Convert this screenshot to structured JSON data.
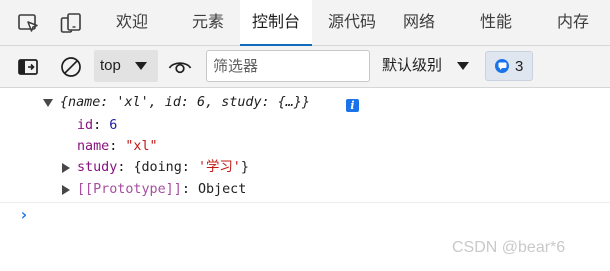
{
  "tabbar": {
    "tabs": [
      {
        "label": "欢迎"
      },
      {
        "label": "元素"
      },
      {
        "label": "控制台"
      },
      {
        "label": "源代码"
      },
      {
        "label": "网络"
      },
      {
        "label": "性能"
      },
      {
        "label": "内存"
      }
    ],
    "active_tab": "控制台"
  },
  "toolbar": {
    "context": "top",
    "filter_placeholder": "筛选器",
    "log_level": "默认级别",
    "issues_count": "3"
  },
  "console": {
    "object_preview": "{name: 'xl', id: 6, study: {…}}",
    "props": [
      {
        "key": "id",
        "sep": ": ",
        "value": "6"
      },
      {
        "key": "name",
        "sep": ": ",
        "value": "\"xl\""
      }
    ],
    "study": {
      "key": "study",
      "sep": ": ",
      "open": "{doing: ",
      "value": "'学习'",
      "close": "}"
    },
    "prototype": {
      "key": "[[Prototype]]",
      "sep": ": ",
      "value": "Object"
    },
    "info_glyph": "i",
    "prompt_glyph": "›"
  },
  "watermark": "CSDN @bear*6",
  "colors": {
    "accent": "#0f6cbd",
    "key": "#881280",
    "number": "#1a1aa6",
    "string": "#c41a16",
    "info": "#1a73e8"
  }
}
